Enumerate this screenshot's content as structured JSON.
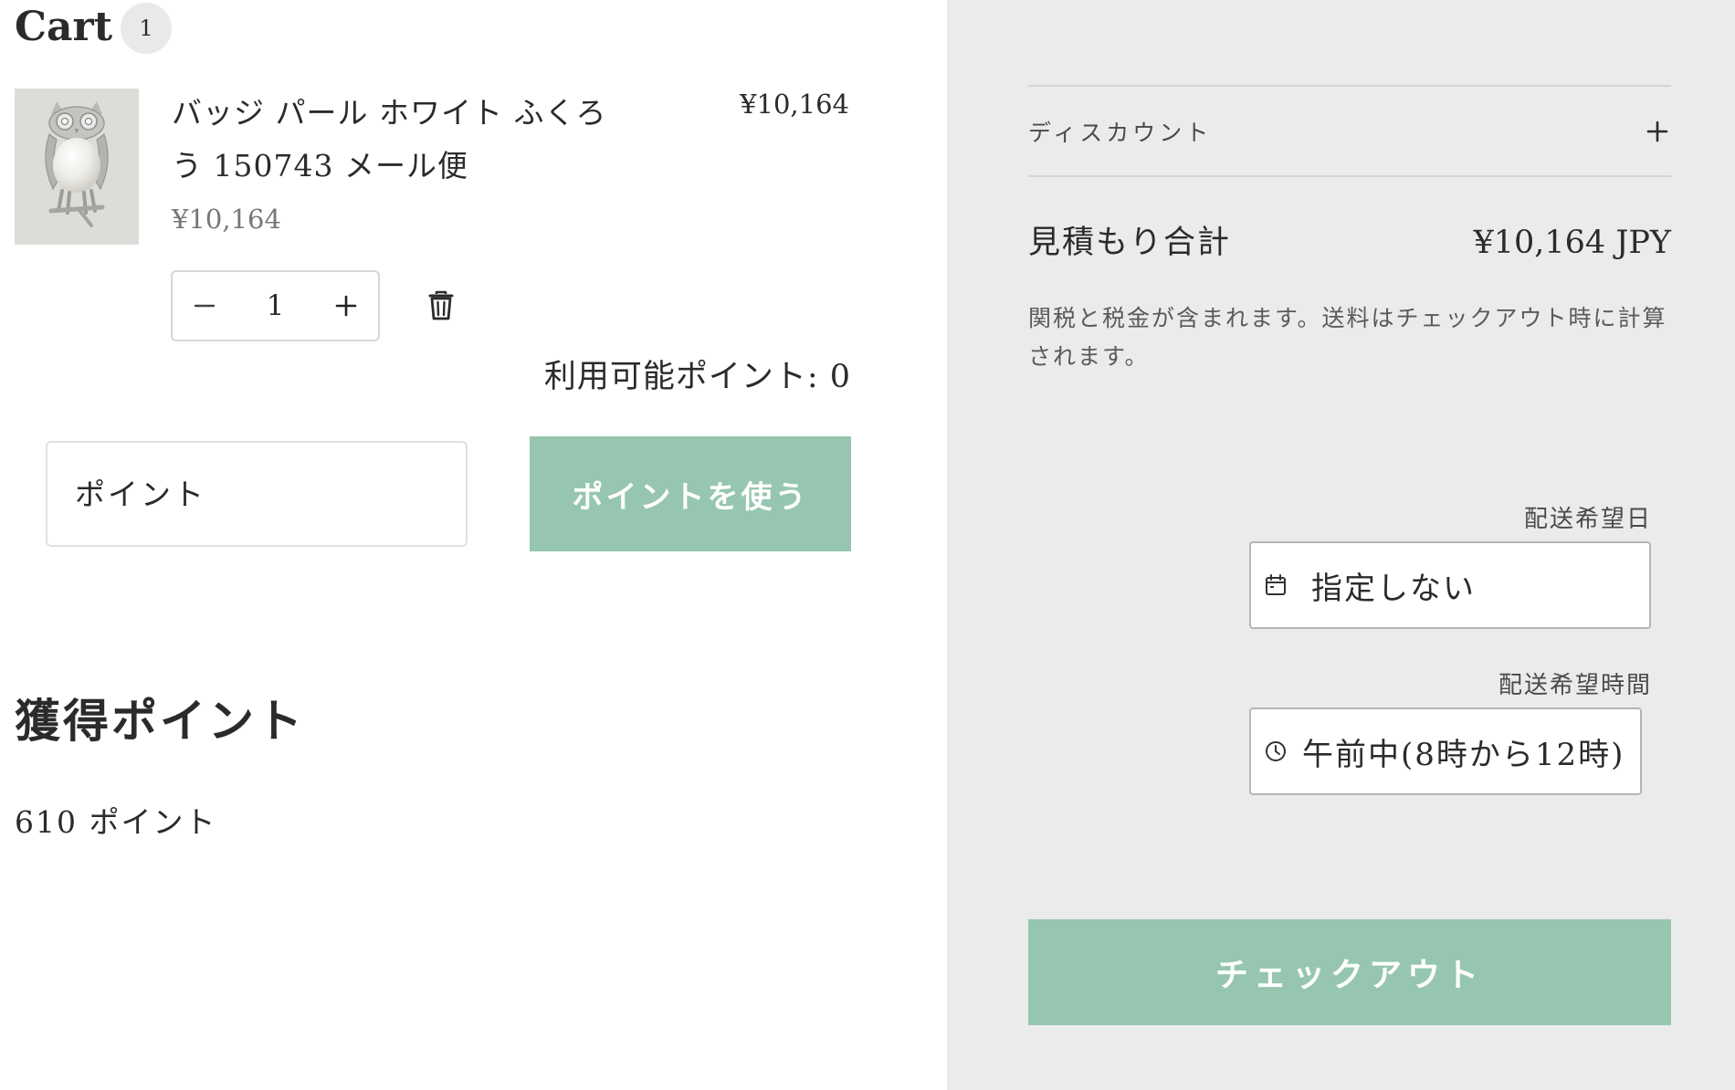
{
  "cart": {
    "title": "Cart",
    "count": "1"
  },
  "item": {
    "name": "バッジ パール ホワイト ふくろう 150743 メール便",
    "unit_price": "¥10,164",
    "line_total": "¥10,164",
    "quantity": "1",
    "image_icon": "owl-brooch-image"
  },
  "points": {
    "available_label": "利用可能ポイント: 0",
    "input_placeholder": "ポイント",
    "apply_label": "ポイントを使う",
    "earned_title": "獲得ポイント",
    "earned_value": "610 ポイント"
  },
  "summary": {
    "discount_label": "ディスカウント",
    "total_label": "見積もり合計",
    "total_value": "¥10,164 JPY",
    "tax_note": "関税と税金が含まれます。送料はチェックアウト時に計算されます。"
  },
  "delivery": {
    "date_label": "配送希望日",
    "date_value": "指定しない",
    "time_label": "配送希望時間",
    "time_value": "午前中(8時から12時)"
  },
  "checkout": {
    "label": "チェックアウト"
  },
  "colors": {
    "accent": "#97c6b0",
    "panel_background": "#ebebeb",
    "text": "#2b2b2b"
  },
  "icons": {
    "minus": "minus-icon",
    "plus": "plus-icon",
    "trash": "trash-icon",
    "calendar": "calendar-icon",
    "clock": "clock-icon"
  }
}
